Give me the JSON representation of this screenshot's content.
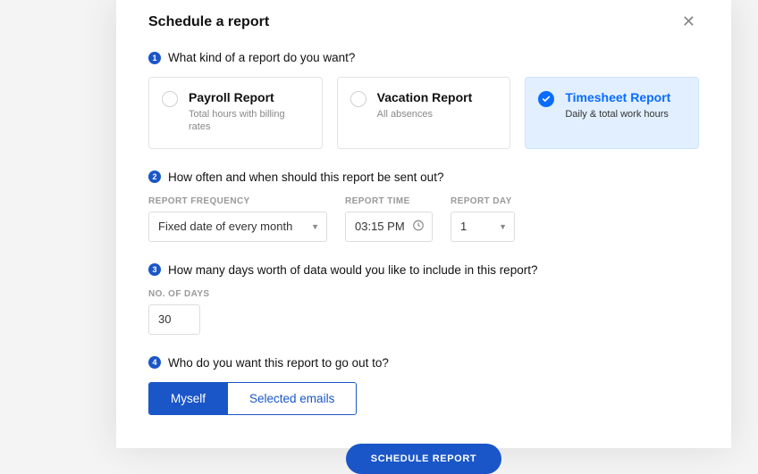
{
  "modal": {
    "title": "Schedule a report"
  },
  "steps": {
    "s1": {
      "num": "1",
      "question": "What kind of a report do you want?"
    },
    "s2": {
      "num": "2",
      "question": "How often and when should this report be sent out?"
    },
    "s3": {
      "num": "3",
      "question": "How many days worth of data would you like to include in this report?"
    },
    "s4": {
      "num": "4",
      "question": "Who do you want this report to go out to?"
    }
  },
  "report_types": {
    "payroll": {
      "title": "Payroll Report",
      "sub": "Total hours with billing rates"
    },
    "vacation": {
      "title": "Vacation Report",
      "sub": "All absences"
    },
    "timesheet": {
      "title": "Timesheet Report",
      "sub": "Daily & total work hours"
    }
  },
  "schedule_fields": {
    "frequency": {
      "label": "REPORT FREQUENCY",
      "value": "Fixed date of every month"
    },
    "time": {
      "label": "REPORT TIME",
      "value": "03:15 PM"
    },
    "day": {
      "label": "REPORT DAY",
      "value": "1"
    }
  },
  "days_field": {
    "label": "NO. OF DAYS",
    "value": "30"
  },
  "recipients": {
    "myself": "Myself",
    "selected": "Selected emails"
  },
  "submit_label": "SCHEDULE REPORT"
}
